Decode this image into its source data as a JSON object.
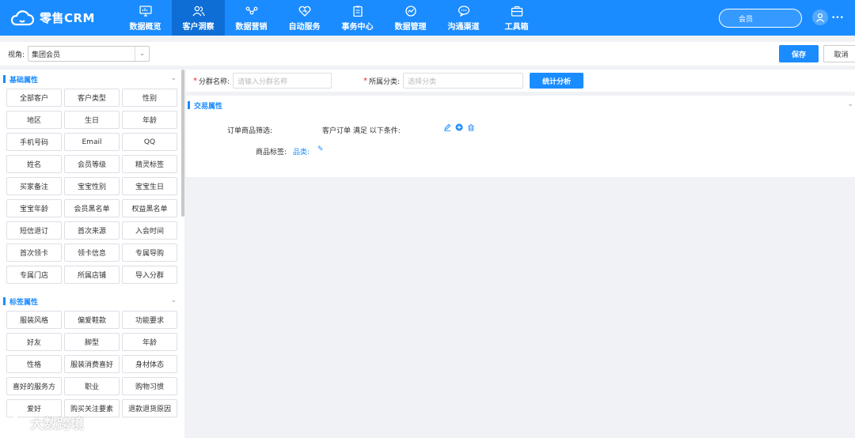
{
  "app": {
    "title": "零售CRM"
  },
  "nav": [
    {
      "label": "数据概览",
      "icon": "monitor-icon",
      "active": false
    },
    {
      "label": "客户洞察",
      "icon": "users-icon",
      "active": true
    },
    {
      "label": "数据营销",
      "icon": "network-icon",
      "active": false
    },
    {
      "label": "自动服务",
      "icon": "heart-shield-icon",
      "active": false
    },
    {
      "label": "事务中心",
      "icon": "clipboard-icon",
      "active": false
    },
    {
      "label": "数据管理",
      "icon": "chart-circle-icon",
      "active": false
    },
    {
      "label": "沟通渠道",
      "icon": "chat-icon",
      "active": false
    },
    {
      "label": "工具箱",
      "icon": "toolbox-icon",
      "active": false
    }
  ],
  "user": {
    "role": "会员",
    "name_blur": "•••"
  },
  "toolbar": {
    "view_label": "视角:",
    "view_value": "集团会员",
    "save_label": "保存",
    "cancel_label": "取消"
  },
  "sections": [
    {
      "title": "基础属性",
      "chips": [
        "全部客户",
        "客户类型",
        "性别",
        "地区",
        "生日",
        "年龄",
        "手机号码",
        "Email",
        "QQ",
        "姓名",
        "会员等级",
        "精灵标签",
        "买家备注",
        "宝宝性别",
        "宝宝生日",
        "宝宝年龄",
        "会员黑名单",
        "权益黑名单",
        "短信退订",
        "首次来源",
        "入会时间",
        "首次领卡",
        "领卡信息",
        "专属导购",
        "专属门店",
        "所属店铺",
        "导入分群"
      ]
    },
    {
      "title": "标签属性",
      "chips": [
        "服装风格",
        "偏爱鞋款",
        "功能要求",
        "好友",
        "脚型",
        "年龄",
        "性格",
        "服装消费喜好",
        "身材体态",
        "喜好的服务方",
        "职业",
        "购物习惯",
        "爱好",
        "购买关注要素",
        "退款退货原因"
      ]
    }
  ],
  "filter": {
    "group_name_label": "分群名称:",
    "group_name_placeholder": "请输入分群名称",
    "category_label": "所属分类:",
    "category_placeholder": "选择分类",
    "analyze_label": "统计分析"
  },
  "transaction": {
    "title": "交易属性",
    "order_filter_label": "订单商品筛选:",
    "condition_text": "客户订单 满足 以下条件:",
    "tag_label": "商品标签:",
    "tag_category": "品类:",
    "tag_edit_glyph": "✎"
  },
  "watermark": {
    "text": "大数跨境"
  },
  "colors": {
    "primary": "#1a8cff",
    "nav_active": "#0f6ed6",
    "required": "#f5222d"
  }
}
